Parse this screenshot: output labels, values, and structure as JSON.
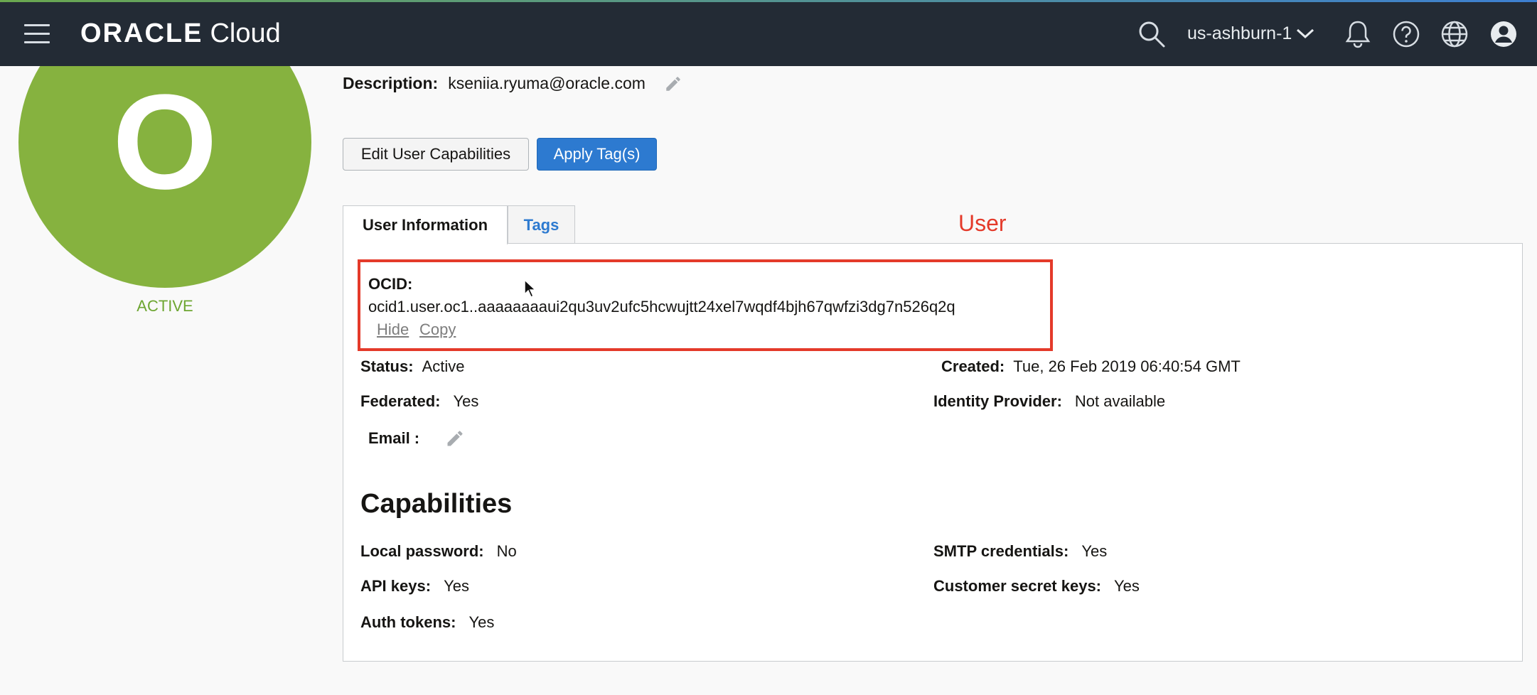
{
  "header": {
    "brand_oracle": "ORACLE",
    "brand_cloud": "Cloud",
    "region": "us-ashburn-1"
  },
  "icons": {
    "menu": "hamburger-icon",
    "search": "search-icon",
    "region_dropdown": "chevron-down-icon",
    "notifications": "bell-icon",
    "help": "help-icon",
    "language": "globe-icon",
    "profile": "user-icon",
    "edit": "pencil-icon"
  },
  "user": {
    "avatar_letter": "O",
    "status_badge": "ACTIVE",
    "description_label": "Description:",
    "description_value": "kseniia.ryuma@oracle.com"
  },
  "actions": {
    "edit_capabilities": "Edit User Capabilities",
    "apply_tags": "Apply Tag(s)"
  },
  "tabs": [
    {
      "label": "User Information",
      "active": true
    },
    {
      "label": "Tags",
      "active": false
    }
  ],
  "annotation": {
    "label": "User"
  },
  "details": {
    "ocid_label": "OCID:",
    "ocid_value": "ocid1.user.oc1..aaaaaaaaui2qu3uv2ufc5hcwujtt24xel7wqdf4bjh67qwfzi3dg7n526q2q",
    "hide": "Hide",
    "copy": "Copy",
    "status_label": "Status:",
    "status_value": "Active",
    "created_label": "Created:",
    "created_value": "Tue, 26 Feb 2019 06:40:54 GMT",
    "federated_label": "Federated:",
    "federated_value": "Yes",
    "idp_label": "Identity Provider:",
    "idp_value": "Not available",
    "email_label": "Email :"
  },
  "capabilities": {
    "title": "Capabilities",
    "local_password_label": "Local password:",
    "local_password_value": "No",
    "smtp_label": "SMTP credentials:",
    "smtp_value": "Yes",
    "api_keys_label": "API keys:",
    "api_keys_value": "Yes",
    "secret_keys_label": "Customer secret keys:",
    "secret_keys_value": "Yes",
    "auth_tokens_label": "Auth tokens:",
    "auth_tokens_value": "Yes"
  },
  "colors": {
    "topbar": "#232b35",
    "avatar": "#86b23f",
    "primary_button": "#2d7ad0",
    "annotation": "#e43a2a",
    "active_status": "#6ea632"
  }
}
